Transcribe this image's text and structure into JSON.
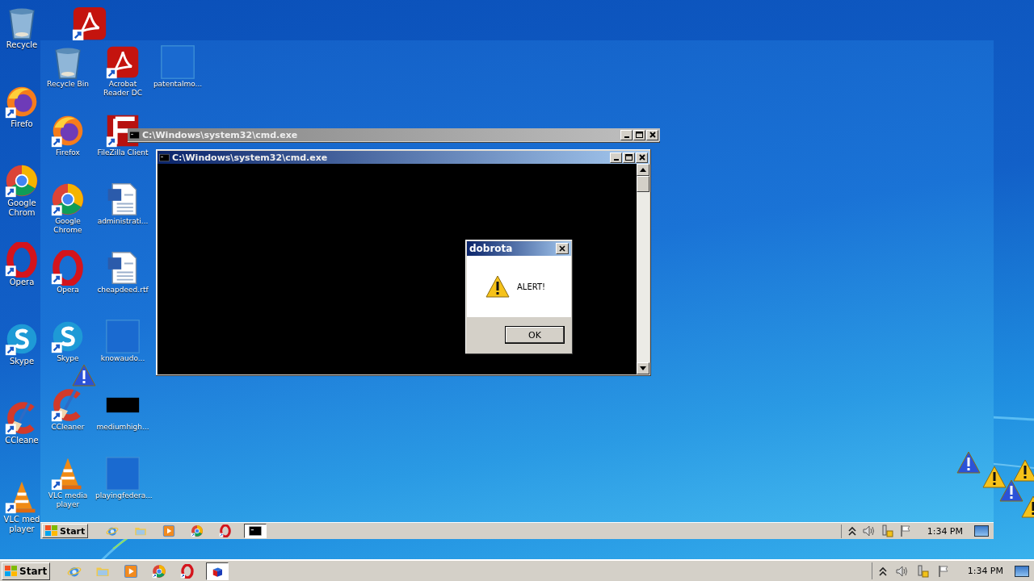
{
  "outer_desktop": {
    "corner_icon": {
      "kind": "acrobat"
    },
    "icons": [
      {
        "label": "Recycle",
        "kind": "recycle"
      },
      {
        "label": "Firefo",
        "kind": "firefox"
      },
      {
        "label": "Google Chrom",
        "kind": "chrome"
      },
      {
        "label": "Opera",
        "kind": "opera"
      },
      {
        "label": "Skype",
        "kind": "skype"
      },
      {
        "label": "CCleane",
        "kind": "ccleaner"
      },
      {
        "label": "VLC med player",
        "kind": "vlc"
      }
    ]
  },
  "screen": {
    "icon_columns": [
      {
        "icons": [
          {
            "label": "Recycle Bin",
            "kind": "recycle"
          },
          {
            "label": "Firefox",
            "kind": "firefox"
          },
          {
            "label": "Google Chrome",
            "kind": "chrome"
          },
          {
            "label": "Opera",
            "kind": "opera"
          },
          {
            "label": "Skype",
            "kind": "skype"
          },
          {
            "label": "CCleaner",
            "kind": "ccleaner"
          },
          {
            "label": "VLC media player",
            "kind": "vlc"
          }
        ]
      },
      {
        "icons": [
          {
            "label": "Acrobat Reader DC",
            "kind": "acrobat"
          },
          {
            "label": "FileZilla Client",
            "kind": "filezilla"
          },
          {
            "label": "administrati...",
            "kind": "word"
          },
          {
            "label": "cheapdeed.rtf",
            "kind": "word"
          },
          {
            "label": "knowaudo...",
            "kind": "blank"
          },
          {
            "label": "mediumhigh...",
            "kind": "black"
          },
          {
            "label": "playingfedera...",
            "kind": "blank"
          }
        ]
      },
      {
        "icons": [
          {
            "label": "patentalmo...",
            "kind": "blank"
          }
        ]
      }
    ],
    "windows": [
      {
        "title": "C:\\Windows\\system32\\cmd.exe",
        "active": false
      },
      {
        "title": "C:\\Windows\\system32\\cmd.exe",
        "active": true
      }
    ],
    "dialog": {
      "title": "dobrota",
      "message": "ALERT!",
      "button": "OK"
    },
    "taskbar": {
      "start": "Start",
      "apps": [
        {
          "kind": "ie",
          "selected": false
        },
        {
          "kind": "folder",
          "selected": false
        },
        {
          "kind": "media",
          "selected": false
        },
        {
          "kind": "chrome",
          "selected": false
        },
        {
          "kind": "opera",
          "selected": false
        },
        {
          "kind": "cmd",
          "selected": true
        }
      ],
      "clock": "1:34 PM"
    }
  },
  "taskbar": {
    "start": "Start",
    "apps": [
      {
        "kind": "ie",
        "selected": false
      },
      {
        "kind": "folder",
        "selected": false
      },
      {
        "kind": "media",
        "selected": false
      },
      {
        "kind": "chrome",
        "selected": false
      },
      {
        "kind": "opera",
        "selected": false
      },
      {
        "kind": "cube",
        "selected": true
      }
    ],
    "clock": "1:34 PM"
  }
}
